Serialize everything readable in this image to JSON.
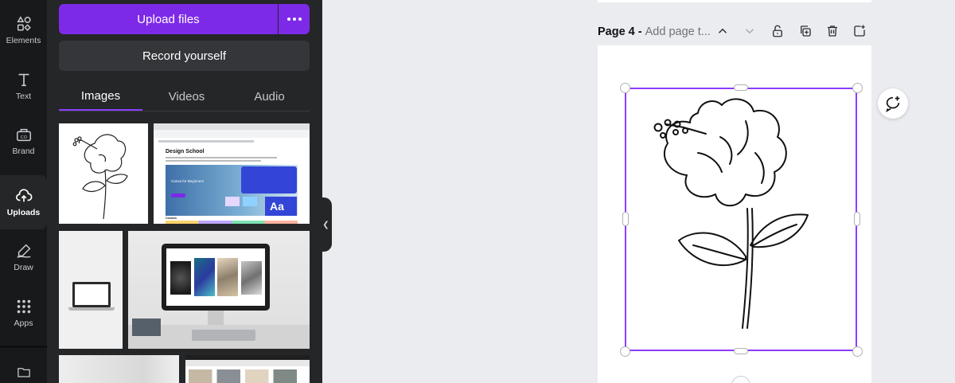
{
  "rail": {
    "items": [
      {
        "label": "Elements",
        "icon": "elements-icon"
      },
      {
        "label": "Text",
        "icon": "text-icon"
      },
      {
        "label": "Brand",
        "icon": "brand-icon"
      },
      {
        "label": "Uploads",
        "icon": "upload-cloud-icon"
      },
      {
        "label": "Draw",
        "icon": "draw-icon"
      },
      {
        "label": "Apps",
        "icon": "apps-icon"
      }
    ],
    "active": "Uploads"
  },
  "panel": {
    "upload_label": "Upload files",
    "record_label": "Record yourself",
    "tabs": [
      {
        "label": "Images"
      },
      {
        "label": "Videos"
      },
      {
        "label": "Audio"
      }
    ],
    "active_tab": "Images",
    "thumbnails": [
      {
        "name": "hibiscus-line-drawing"
      },
      {
        "name": "design-school-screenshot",
        "text": {
          "heading": "Design School",
          "card": "Canva for Beginners",
          "courses": "Courses"
        }
      },
      {
        "name": "laptop-on-white"
      },
      {
        "name": "desktop-monitor-photo"
      },
      {
        "name": "white-room-photo"
      },
      {
        "name": "browser-screenshot"
      }
    ]
  },
  "canvas": {
    "page_label": "Page 4 -",
    "page_title_placeholder": "Add page t...",
    "header_icons": [
      "chevron-up-icon",
      "chevron-down-icon",
      "lock-icon",
      "duplicate-icon",
      "trash-icon",
      "add-page-icon"
    ],
    "accent": "#8b3dff"
  },
  "colors": {
    "purple": "#7d2ae8",
    "rail_bg": "#18191b",
    "panel_bg": "#252627",
    "workspace_bg": "#ebecf0"
  }
}
